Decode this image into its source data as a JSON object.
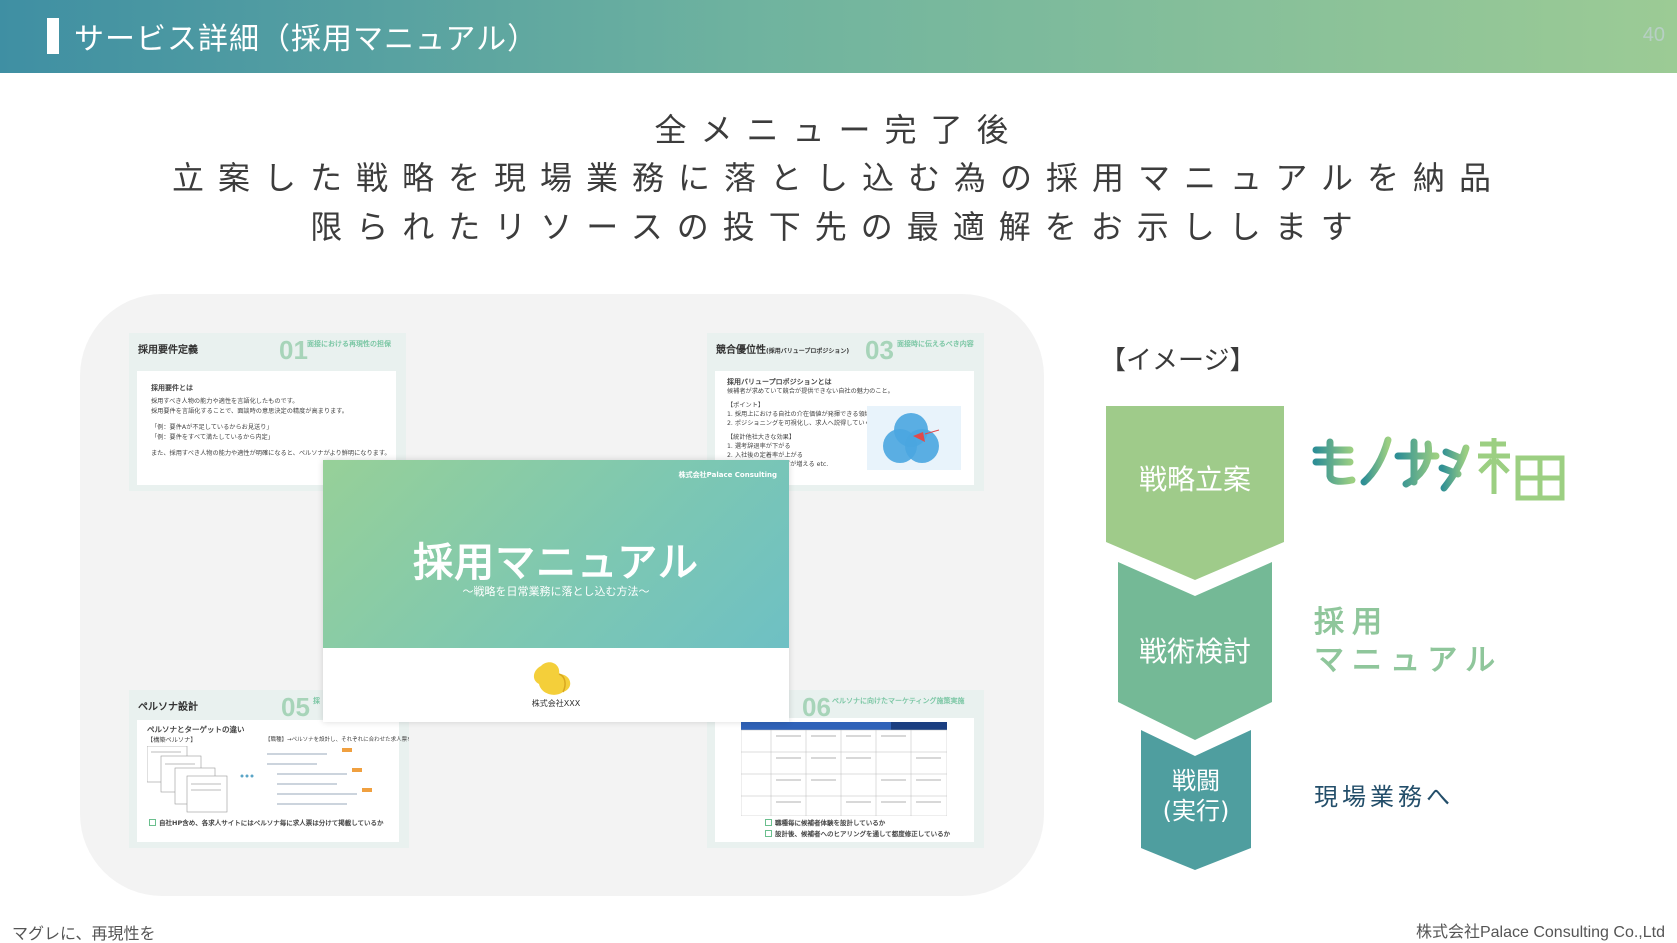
{
  "header": {
    "title": "サービス詳細（採用マニュアル）",
    "page_number": "40"
  },
  "intro": {
    "line1": "全メニュー完了後",
    "line2": "立案した戦略を現場業務に落とし込む為の採用マニュアルを納品",
    "line3": "限られたリソースの投下先の最適解をお示しします"
  },
  "thumbnails": {
    "t1": {
      "title": "採用要件定義",
      "num": "01",
      "sub": "面接における再現性の担保",
      "lines": [
        "採用要件とは",
        "採用すべき人物の能力や適性を言語化したものです。",
        "採用要件を言語化することで、面談時の意思決定の精度が高まります。",
        "「例：要件Aが不足しているからお見送り」",
        "「例：要件をすべて満たしているから内定」",
        "また、採用すべき人物の能力や適性が明確になると、ペルソナがより鮮明になります。"
      ]
    },
    "t2": {
      "title": "競合優位性",
      "title_sub": "(採用バリュープロポジション)",
      "num": "03",
      "sub": "面接時に伝えるべき内容",
      "lines": [
        "採用バリュープロポジションとは",
        "候補者が求めていて競合が提供できない自社の魅力のこと。",
        "【ポイント】",
        "1. 採用上における自社の介在価値が発揮できる領域",
        "2. ポジショニングを可視化し、求人へ説得していく",
        "【統計他社大きな効果】",
        "1. 選考辞退率が下がる",
        "2. 入社後の定着率が上がる",
        "3. 採用ブランディングが増える etc."
      ]
    },
    "t3": {
      "title": "ペルソナ設計",
      "num": "05",
      "sub": "採",
      "heading": "ペルソナとターゲットの違い",
      "persona_label": "【構築ペルソナ】",
      "right_note": "【職種】→ペルソナを設計し、それぞれに合わせた求人票を作成。",
      "check": "自社HP含め、各求人サイトにはペルソナ毎に求人票は分けて掲載しているか"
    },
    "t4": {
      "title": "",
      "num": "06",
      "sub": "ペルソナに向けたマーケティング施策実施",
      "checks": [
        "職種毎に候補者体験を設計しているか",
        "設計後、候補者へのヒアリングを通して都度修正しているか"
      ]
    }
  },
  "cover": {
    "company_top": "株式会社Palace Consulting",
    "title": "採用マニュアル",
    "subtitle": "〜戦略を日常業務に落とし込む方法〜",
    "company_bottom": "株式会社XXX"
  },
  "right": {
    "image_label": "【イメージ】",
    "steps": [
      "戦略立案",
      "戦術検討",
      "戦闘\n(実行)"
    ],
    "brand_logo_text": "モノサシ採用",
    "manual_text": "採用\nマニュアル",
    "field_text": "現場業務へ"
  },
  "footer": {
    "left": "マグレに、再現性を",
    "right": "株式会社Palace Consulting Co.,Ltd"
  },
  "colors": {
    "header_start": "#3f8fa3",
    "header_end": "#9ccb95",
    "step1": "#9fcb8a",
    "step2": "#74b996",
    "step3": "#4f9e9f",
    "field_text": "#234e6a"
  }
}
